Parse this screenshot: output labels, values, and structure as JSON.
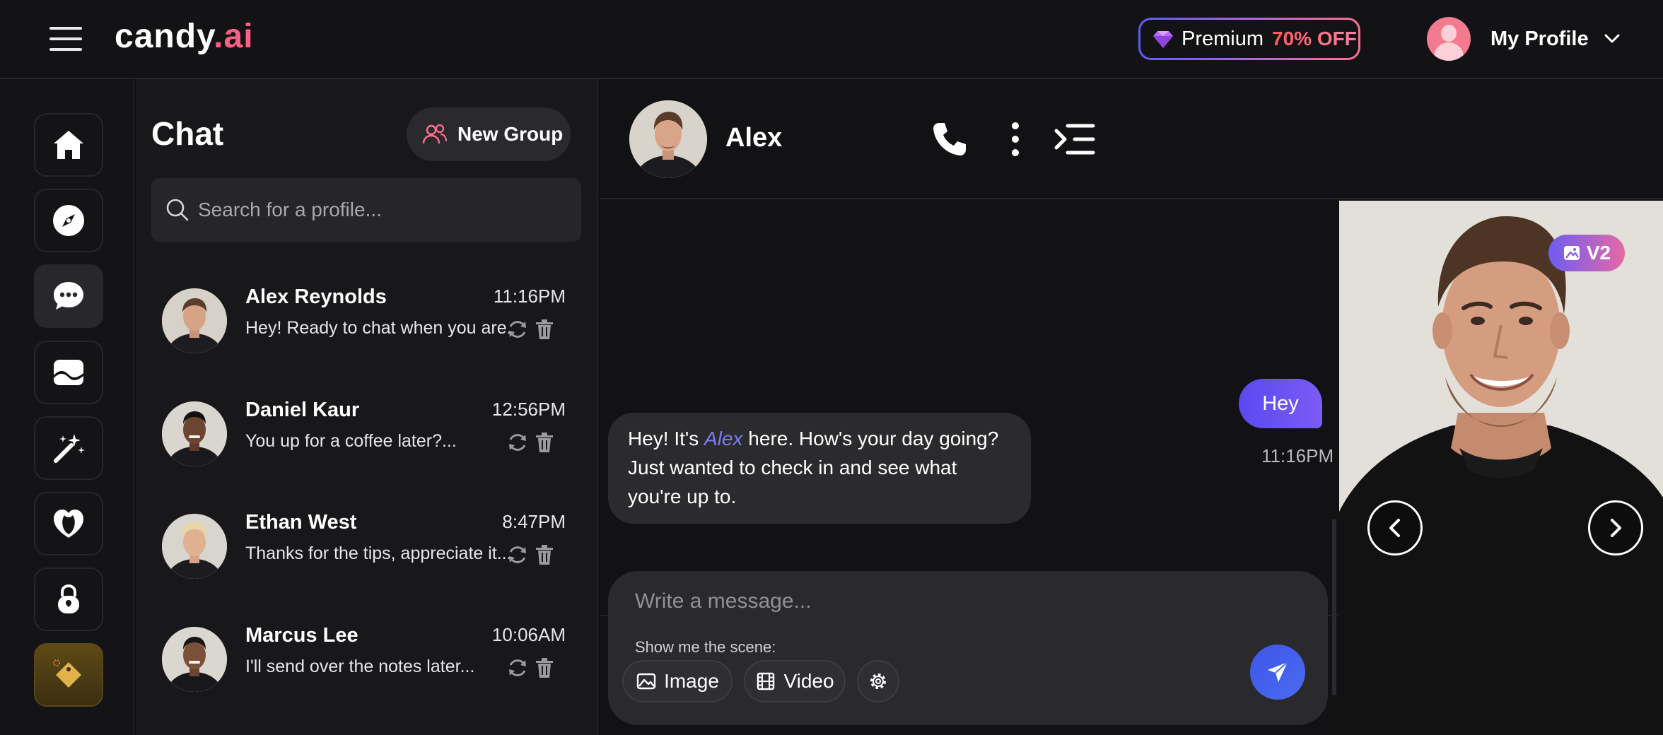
{
  "topbar": {
    "logo_main": "candy",
    "logo_accent": ".ai",
    "premium_label": "Premium",
    "premium_discount": "70% OFF",
    "profile_label": "My Profile"
  },
  "rail": {
    "items": [
      "home",
      "explore",
      "chat",
      "gallery",
      "create",
      "my-ai",
      "private-content",
      "premium"
    ]
  },
  "chatlist": {
    "title": "Chat",
    "new_group_label": "New Group",
    "search_placeholder": "Search for a profile...",
    "contacts": [
      {
        "name": "Alex Reynolds",
        "time": "11:16PM",
        "preview": "Hey! Ready to chat when you are..."
      },
      {
        "name": "Daniel Kaur",
        "time": "12:56PM",
        "preview": "You up for a coffee later?..."
      },
      {
        "name": "Ethan West",
        "time": "8:47PM",
        "preview": "Thanks for the tips, appreciate it..."
      },
      {
        "name": "Marcus Lee",
        "time": "10:06AM",
        "preview": "I'll send over the notes later..."
      }
    ]
  },
  "conversation": {
    "name": "Alex",
    "outgoing": {
      "text": "Hey",
      "time": "11:16PM"
    },
    "incoming": {
      "part1": "Hey! It's ",
      "highlight": "Alex",
      "part2": " here. How's your day going? Just wanted to check in and see what you're up to."
    },
    "composer": {
      "placeholder": "Write a message...",
      "scene_label": "Show me the scene:",
      "image_label": "Image",
      "video_label": "Video"
    }
  },
  "photo": {
    "badge": "V2"
  },
  "colors": {
    "accent_pink": "#ff5f85",
    "send_blue": "#4b6cf0",
    "bubble_purple": "#6a52f3",
    "gold": "#e2b24a"
  }
}
